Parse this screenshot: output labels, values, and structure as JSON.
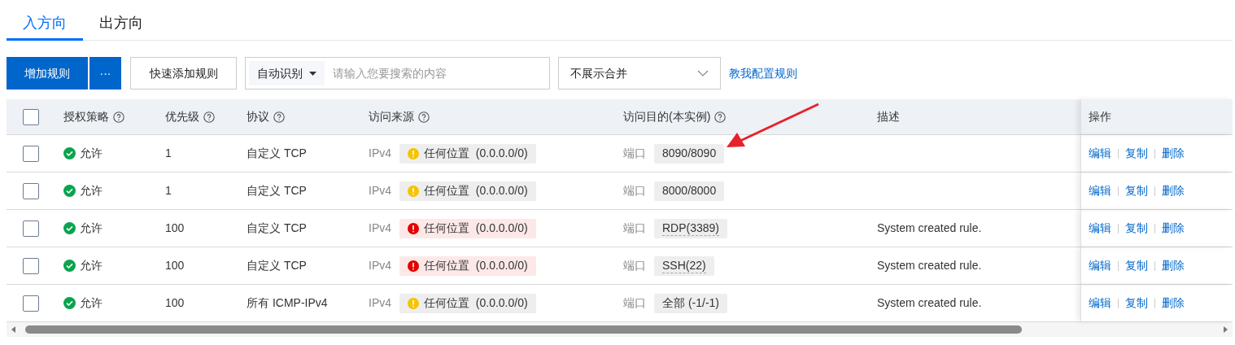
{
  "tabs": [
    {
      "label": "入方向",
      "selected": true
    },
    {
      "label": "出方向",
      "selected": false
    }
  ],
  "toolbar": {
    "add_button": "增加规则",
    "more_button": "···",
    "quick_add_button": "快速添加规则",
    "search": {
      "prefix": "自动识别",
      "placeholder": "请输入您要搜索的内容"
    },
    "merge_select": "不展示合并",
    "help_link": "教我配置规则"
  },
  "table": {
    "all_checked": false,
    "columns": [
      {
        "label": "授权策略",
        "help": true
      },
      {
        "label": "优先级",
        "help": true
      },
      {
        "label": "协议",
        "help": true
      },
      {
        "label": "访问来源",
        "help": true
      },
      {
        "label": "访问目的(本实例)",
        "help": true
      },
      {
        "label": "描述",
        "help": false
      },
      {
        "label": "操作",
        "help": false
      }
    ],
    "rows": [
      {
        "checked": false,
        "policy": "允许",
        "priority": "1",
        "protocol": "自定义 TCP",
        "ip": "IPv4",
        "source": {
          "danger": false,
          "label": "任何位置",
          "cidr": "(0.0.0.0/0)"
        },
        "dest_label": "端口",
        "dest": {
          "text": "8090/8090",
          "underlined": false
        },
        "description": "",
        "actions": [
          "编辑",
          "复制",
          "删除"
        ]
      },
      {
        "checked": false,
        "policy": "允许",
        "priority": "1",
        "protocol": "自定义 TCP",
        "ip": "IPv4",
        "source": {
          "danger": false,
          "label": "任何位置",
          "cidr": "(0.0.0.0/0)"
        },
        "dest_label": "端口",
        "dest": {
          "text": "8000/8000",
          "underlined": false
        },
        "description": "",
        "actions": [
          "编辑",
          "复制",
          "删除"
        ]
      },
      {
        "checked": false,
        "policy": "允许",
        "priority": "100",
        "protocol": "自定义 TCP",
        "ip": "IPv4",
        "source": {
          "danger": true,
          "label": "任何位置",
          "cidr": "(0.0.0.0/0)"
        },
        "dest_label": "端口",
        "dest": {
          "text": "RDP(3389)",
          "underlined": true
        },
        "description": "System created rule.",
        "actions": [
          "编辑",
          "复制",
          "删除"
        ]
      },
      {
        "checked": false,
        "policy": "允许",
        "priority": "100",
        "protocol": "自定义 TCP",
        "ip": "IPv4",
        "source": {
          "danger": true,
          "label": "任何位置",
          "cidr": "(0.0.0.0/0)"
        },
        "dest_label": "端口",
        "dest": {
          "text": "SSH(22)",
          "underlined": true
        },
        "description": "System created rule.",
        "actions": [
          "编辑",
          "复制",
          "删除"
        ]
      },
      {
        "checked": false,
        "policy": "允许",
        "priority": "100",
        "protocol": "所有 ICMP-IPv4",
        "ip": "IPv4",
        "source": {
          "danger": false,
          "label": "任何位置",
          "cidr": "(0.0.0.0/0)"
        },
        "dest_label": "端口",
        "dest": {
          "text": "全部 (-1/-1)",
          "underlined": false
        },
        "description": "System created rule.",
        "actions": [
          "编辑",
          "复制",
          "删除"
        ]
      }
    ]
  }
}
